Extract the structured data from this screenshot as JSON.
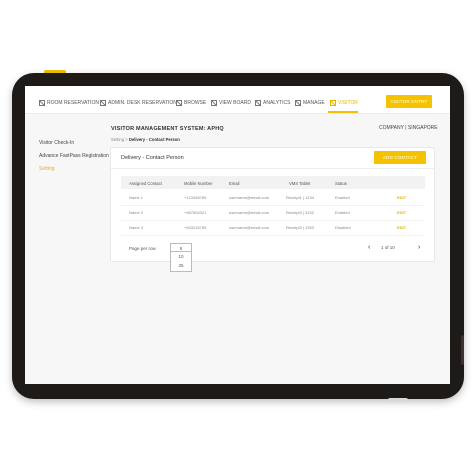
{
  "nav": {
    "items": [
      {
        "label": "ROOM RESERVATION",
        "icon": "room-icon"
      },
      {
        "label": "ADMIN. DESK RESERVATION",
        "icon": "desk-icon"
      },
      {
        "label": "BROWSE",
        "icon": "browse-icon"
      },
      {
        "label": "VIEW BOARD",
        "icon": "board-icon"
      },
      {
        "label": "ANALYTICS",
        "icon": "analytics-icon"
      },
      {
        "label": "MANAGE",
        "icon": "manage-icon"
      },
      {
        "label": "VISITOR",
        "icon": "visitor-icon"
      }
    ],
    "cta_label": "VISITOR ENTRY"
  },
  "sidebar": {
    "items": [
      {
        "label": "Visitor Check-In"
      },
      {
        "label": "Advance FastPass Registration"
      },
      {
        "label": "Setting"
      }
    ]
  },
  "page": {
    "title": "VISITOR MANAGEMENT SYSTEM: APHQ",
    "company": "COMPANY | SINGAPORE",
    "breadcrumb": {
      "parent": "Setting",
      "sep1": ">",
      "mid": "Delivery",
      "sep2": "-",
      "current": "Contact Person"
    }
  },
  "card": {
    "title": "Delivery - Contact Person",
    "add_label": "ADD CONTACT"
  },
  "table": {
    "columns": [
      "Assigned Contact",
      "Mobile Number",
      "Email",
      "VMS Tablet",
      "Status"
    ],
    "rows": [
      {
        "name": "Name 1",
        "mobile": "+123456789",
        "email": "username@email.com",
        "tablet": "Receipt1 | 1234",
        "status": "Enabled",
        "action": "EDIT"
      },
      {
        "name": "Name 2",
        "mobile": "+987654321",
        "email": "username@email.com",
        "tablet": "Receipt3 | 3152",
        "status": "Enabled",
        "action": "EDIT"
      },
      {
        "name": "Name 3",
        "mobile": "+543216789",
        "email": "username@email.com",
        "tablet": "Receipt3 | 1353",
        "status": "Disabled",
        "action": "EDIT"
      }
    ]
  },
  "pagination": {
    "per_page_label": "Page per row",
    "selected": "5",
    "options": [
      "10",
      "25"
    ],
    "page_info": "1 of 10",
    "prev_icon": "chevron-left-icon",
    "next_icon": "chevron-right-icon"
  },
  "colors": {
    "accent": "#f5c200",
    "bezel": "#1e1a17"
  }
}
